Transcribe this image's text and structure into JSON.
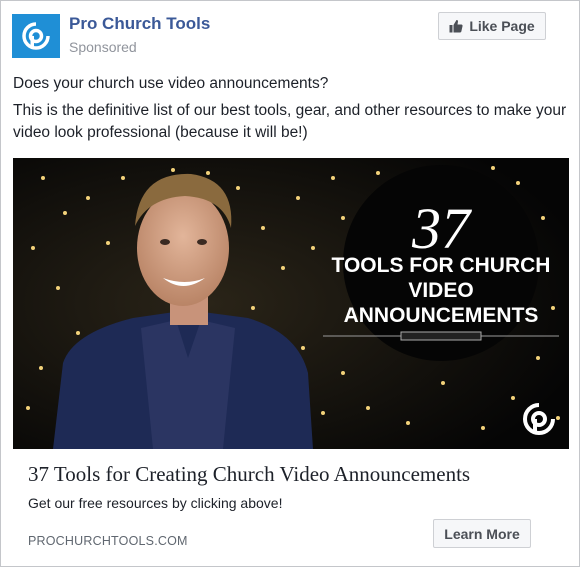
{
  "page": {
    "name": "Pro Church Tools",
    "sponsored_label": "Sponsored",
    "like_button_label": "Like Page",
    "brand_color": "#1f8fd6"
  },
  "post": {
    "line1": "Does your church use video announcements?",
    "line2": "This is the definitive list of our best tools, gear, and other resources to make your video look professional (because it will be!)"
  },
  "ad_image": {
    "number": "37",
    "headline_lines": [
      "TOOLS FOR CHURCH",
      "VIDEO",
      "ANNOUNCEMENTS"
    ],
    "logo_icon": "pro-church-tools-logo"
  },
  "link": {
    "title": "37 Tools for Creating Church Video Announcements",
    "description": "Get our free resources by clicking above!",
    "domain": "PROCHURCHTOOLS.COM",
    "cta_label": "Learn More"
  },
  "icons": {
    "like": "thumbs-up-icon",
    "avatar": "pro-church-tools-logo-icon"
  }
}
